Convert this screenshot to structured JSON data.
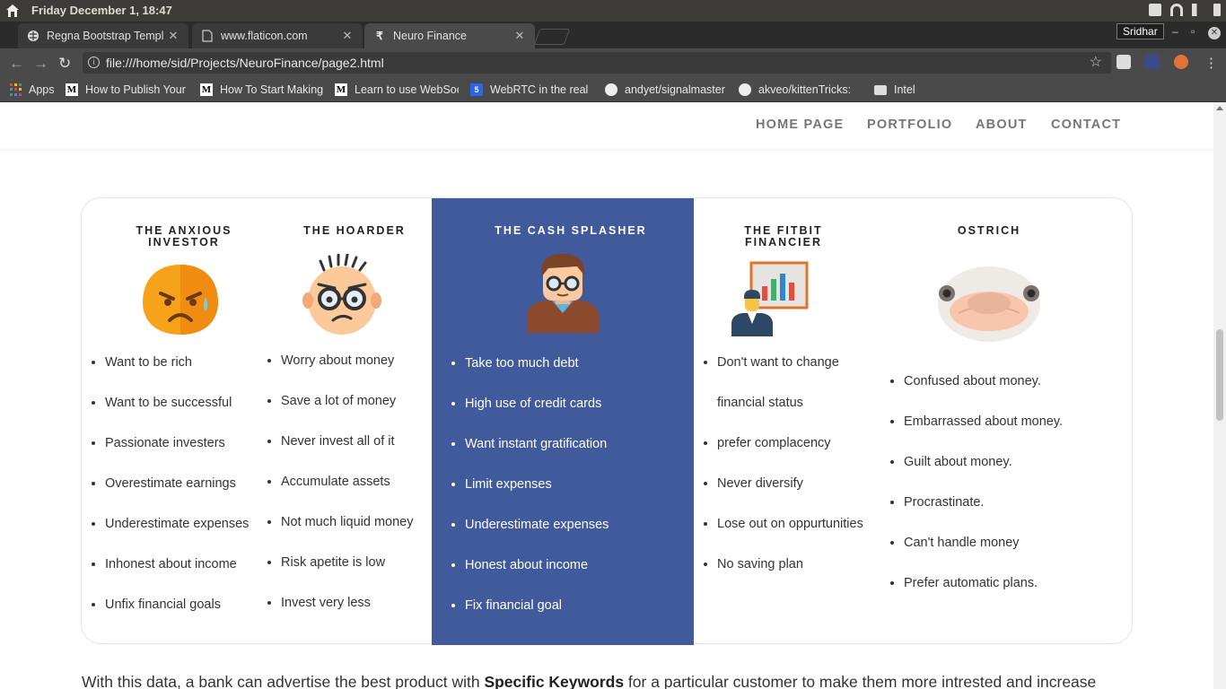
{
  "os": {
    "clock": "Friday December  1, 18:47"
  },
  "browser": {
    "tabs": [
      {
        "title": "Regna Bootstrap Templ",
        "favicon": "brain-icon"
      },
      {
        "title": "www.flaticon.com",
        "favicon": "page-icon"
      },
      {
        "title": "Neuro Finance",
        "favicon": "rupee-icon"
      }
    ],
    "profile": "Sridhar",
    "url": "file:///home/sid/Projects/NeuroFinance/page2.html",
    "bookmarks": [
      {
        "label": "Apps",
        "icon": "apps-grid-icon"
      },
      {
        "label": "How to Publish Your",
        "icon": "medium-icon"
      },
      {
        "label": "How To Start Making",
        "icon": "medium-icon"
      },
      {
        "label": "Learn to use WebSoc",
        "icon": "medium-icon"
      },
      {
        "label": "WebRTC in the real",
        "icon": "css3-icon"
      },
      {
        "label": "andyet/signalmaster",
        "icon": "github-icon"
      },
      {
        "label": "akveo/kittenTricks:",
        "icon": "github-icon"
      },
      {
        "label": "Intel",
        "icon": "folder-icon"
      }
    ]
  },
  "site": {
    "nav": [
      "HOME PAGE",
      "PORTFOLIO",
      "ABOUT",
      "CONTACT"
    ],
    "accent": "#405a9b",
    "columns": [
      {
        "title_line1": "THE ANXIOUS",
        "title_line2": "INVESTOR",
        "icon": "worried-face-icon",
        "items": [
          "Want to be rich",
          "Want to be successful",
          "Passionate investers",
          "Overestimate earnings",
          "Underestimate expenses",
          "Inhonest about income",
          "Unfix financial goals"
        ]
      },
      {
        "title_line1": "THE HOARDER",
        "title_line2": "",
        "icon": "grumpy-glasses-face-icon",
        "items": [
          "Worry about money",
          "Save a lot of money",
          "Never invest all of it",
          "Accumulate assets",
          "Not much liquid money",
          "Risk apetite is low",
          "Invest very less"
        ]
      },
      {
        "title_line1": "THE CASH SPLASHER",
        "title_line2": "",
        "icon": "businessman-avatar-icon",
        "items": [
          "Take too much debt",
          "High use of credit cards",
          "Want instant gratification",
          "Limit expenses",
          "Underestimate expenses",
          "Honest about income",
          "Fix financial goal"
        ]
      },
      {
        "title_line1": "THE FITBIT",
        "title_line2": "FINANCIER",
        "icon": "presenter-chart-icon",
        "items": [
          "Don't want to change",
          "financial status",
          "prefer complacency",
          "Never diversify",
          "Lose out on oppurtunities",
          "No saving plan"
        ]
      },
      {
        "title_line1": "OSTRICH",
        "title_line2": "",
        "icon": "ostrich-face-icon",
        "items": [
          "Confused about money.",
          "Embarrassed about money.",
          "Guilt about money.",
          "Procrastinate.",
          "Can't handle money",
          "Prefer automatic plans."
        ]
      }
    ],
    "bottom": {
      "before": "With this data, a bank can advertise the best product with ",
      "bold": "Specific Keywords",
      "after": " for a particular customer to make them more intrested and increase"
    }
  }
}
